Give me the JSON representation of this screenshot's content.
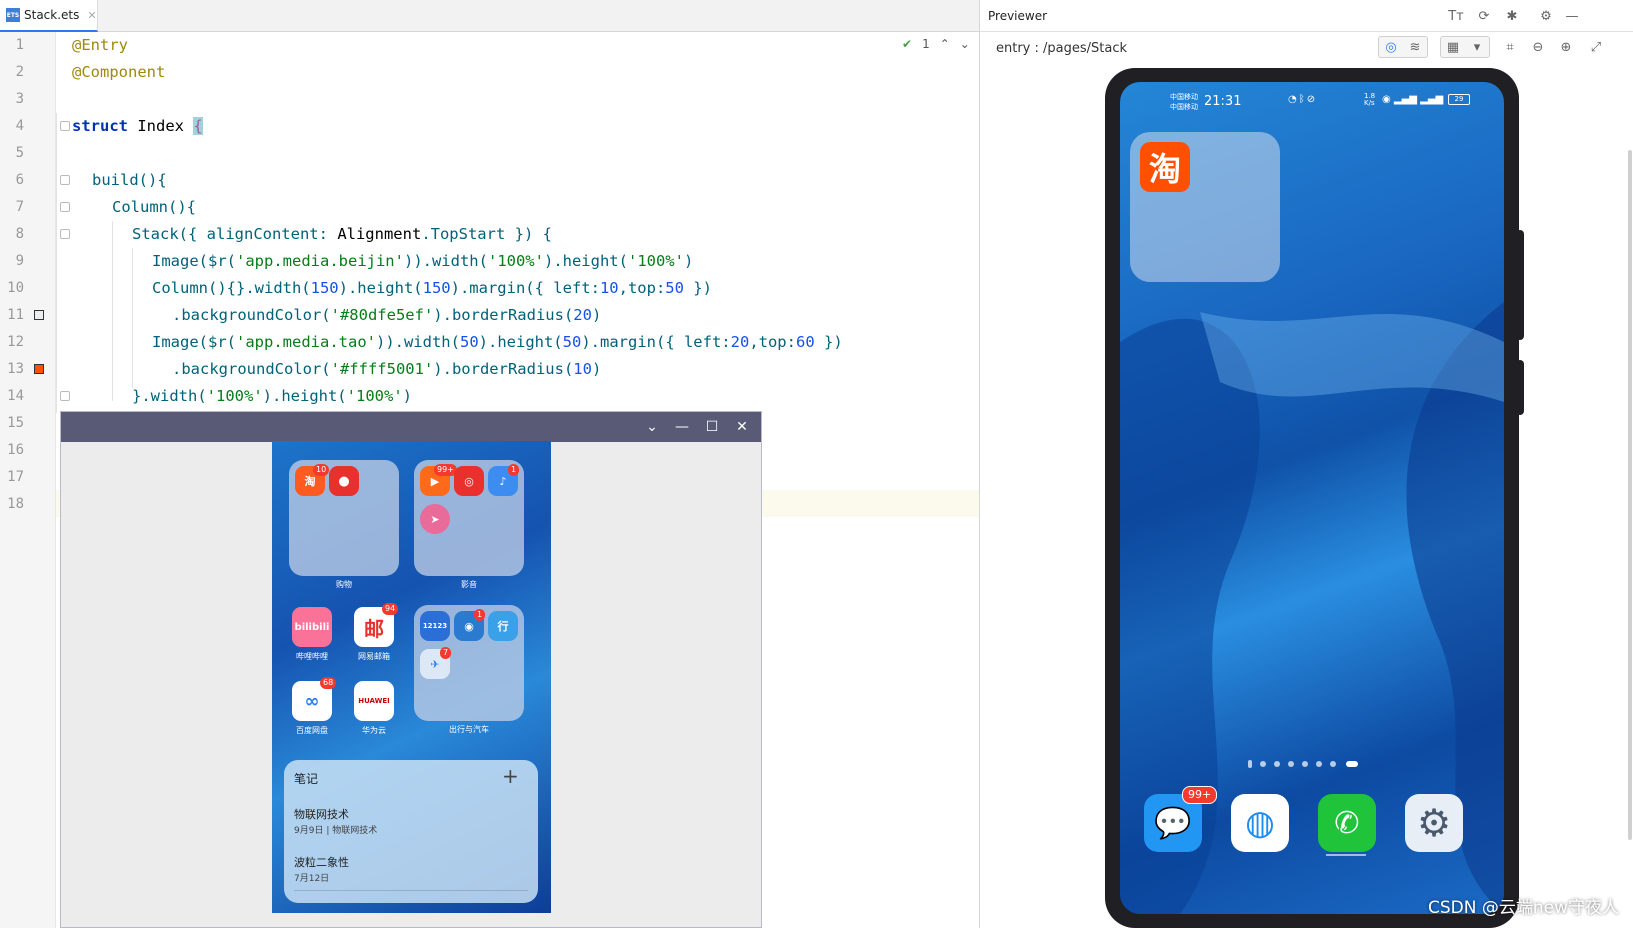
{
  "editor": {
    "tab_label": "Stack.ets",
    "file_icon_text": "ETS",
    "inspection_count": "1",
    "lines": [
      {
        "n": "1"
      },
      {
        "n": "2"
      },
      {
        "n": "3"
      },
      {
        "n": "4"
      },
      {
        "n": "5"
      },
      {
        "n": "6"
      },
      {
        "n": "7"
      },
      {
        "n": "8"
      },
      {
        "n": "9"
      },
      {
        "n": "10"
      },
      {
        "n": "11"
      },
      {
        "n": "12"
      },
      {
        "n": "13"
      },
      {
        "n": "14"
      },
      {
        "n": "15"
      },
      {
        "n": "16"
      },
      {
        "n": "17"
      },
      {
        "n": "18"
      }
    ],
    "code": {
      "l1": "@Entry",
      "l2": "@Component",
      "l4a": "struct",
      "l4b": " Index ",
      "l4c": "{",
      "l6": "build(){",
      "l7": "Column(){",
      "l8a": "Stack({ alignContent: ",
      "l8b": "Alignment",
      "l8c": ".TopStart }) {",
      "l9a": "Image($r(",
      "l9b": "'app.media.beijin'",
      "l9c": ")).width(",
      "l9d": "'100%'",
      "l9e": ").height(",
      "l9f": "'100%'",
      "l9g": ")",
      "l10a": "Column(){}.width(",
      "l10b": "150",
      "l10c": ").height(",
      "l10d": "150",
      "l10e": ").margin({ left:",
      "l10f": "10",
      "l10g": ",top:",
      "l10h": "50",
      "l10i": " })",
      "l11a": ".backgroundColor(",
      "l11b": "'#80dfe5ef'",
      "l11c": ").borderRadius(",
      "l11d": "20",
      "l11e": ")",
      "l12a": "Image($r(",
      "l12b": "'app.media.tao'",
      "l12c": ")).width(",
      "l12d": "50",
      "l12e": ").height(",
      "l12f": "50",
      "l12g": ").margin({ left:",
      "l12h": "20",
      "l12i": ",top:",
      "l12j": "60",
      "l12k": " })",
      "l13a": ".backgroundColor(",
      "l13b": "'#ffff5001'",
      "l13c": ").borderRadius(",
      "l13d": "10",
      "l13e": ")",
      "l14a": "}.width(",
      "l14b": "'100%'",
      "l14c": ").height(",
      "l14d": "'100%'",
      "l14e": ")"
    }
  },
  "emulator": {
    "folder1_label": "购物",
    "folder2_label": "影音",
    "folder3_label": "出行与汽车",
    "apps": {
      "bilibili_label": "哔哩哔哩",
      "mail_label": "网易邮箱",
      "baidu_label": "百度网盘",
      "huawei_label": "华为云"
    },
    "badges": {
      "taobao": "10",
      "video": "99+",
      "music": "1",
      "mail": "94",
      "baidu": "68",
      "train": "1",
      "plane": "7"
    },
    "icon_texts": {
      "taobao": "淘",
      "bilibili": "bilibili",
      "mail": "邮",
      "huawei": "HUAWEI",
      "road": "12123",
      "go": "行"
    },
    "notes": {
      "title": "笔记",
      "item1_title": "物联网技术",
      "item1_sub": "9月9日 | 物联网技术",
      "item2_title": "波粒二象性",
      "item2_sub": "7月12日"
    }
  },
  "previewer": {
    "title": "Previewer",
    "route": "entry : /pages/Stack",
    "status": {
      "carrier1": "中国移动",
      "carrier2": "中国移动",
      "time": "21:31",
      "speed": "1.8 K/s",
      "battery": "29"
    },
    "tao_icon": "淘",
    "messages_badge": "99+",
    "watermark": "CSDN @云端new守夜人"
  },
  "colors": {
    "folder_overlay": "#80dfe5ef",
    "tao_bg": "#ff5001",
    "accent": "#3574f0"
  }
}
